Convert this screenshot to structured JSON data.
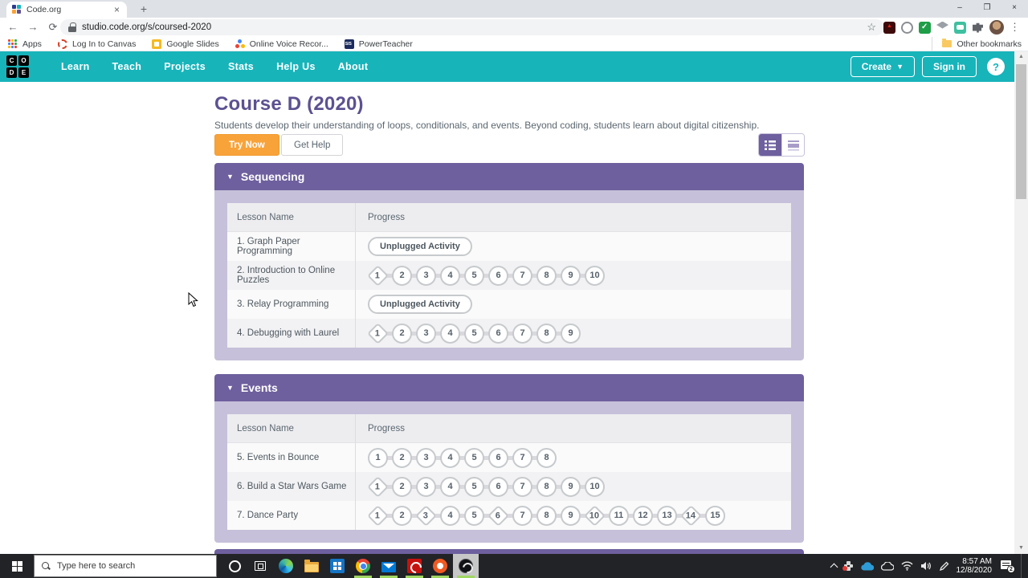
{
  "ui_glyphs": {
    "back": "←",
    "forward": "→",
    "reload": "⟳",
    "star": "☆",
    "menu_dots": "⋮",
    "tab_close": "×",
    "new_tab": "+",
    "win_min": "–",
    "win_max": "❐",
    "win_close": "×",
    "caret_down": "▼",
    "scroll_up": "▲",
    "scroll_down": "▼"
  },
  "browser": {
    "tab_title": "Code.org",
    "url": "studio.code.org/s/coursed-2020",
    "bookmarks": [
      {
        "label": "Apps",
        "icon": "apps-grid-icon",
        "cls": "bm-apps",
        "dots": 9
      },
      {
        "label": "Log In to Canvas",
        "icon": "canvas-icon",
        "cls": "bm-canvas",
        "dots": 0
      },
      {
        "label": "Google Slides",
        "icon": "google-slides-icon",
        "cls": "bm-slides",
        "dots": 0
      },
      {
        "label": "Online Voice Recor...",
        "icon": "voice-recorder-icon",
        "cls": "bm-voice",
        "dots": 3
      },
      {
        "label": "PowerTeacher",
        "icon": "sis-icon",
        "cls": "bm-sis",
        "dots": 0
      }
    ],
    "other_bookmarks_label": "Other bookmarks",
    "extensions": [
      {
        "icon": "acrobat-extension-icon",
        "cls": "ext-acrobat"
      },
      {
        "icon": "ring-extension-icon",
        "cls": "ext-ring"
      },
      {
        "icon": "check-extension-icon",
        "cls": "ext-check"
      },
      {
        "icon": "dropbox-extension-icon",
        "cls": "ext-dropbox"
      },
      {
        "icon": "screencast-extension-icon",
        "cls": "ext-screencast"
      },
      {
        "icon": "extensions-puzzle-icon",
        "cls": "ext-puzzle"
      }
    ]
  },
  "site_nav": {
    "logo_letters": [
      "C",
      "O",
      "D",
      "E"
    ],
    "items": [
      "Learn",
      "Teach",
      "Projects",
      "Stats",
      "Help Us",
      "About"
    ],
    "create_label": "Create",
    "sign_in_label": "Sign in",
    "help_label": "?"
  },
  "page": {
    "title": "Course D (2020)",
    "description": "Students develop their understanding of loops, conditionals, and events. Beyond coding, students learn about digital citizenship.",
    "try_now_label": "Try Now",
    "get_help_label": "Get Help"
  },
  "table": {
    "lesson_col": "Lesson Name",
    "progress_col": "Progress",
    "unplugged_label": "Unplugged Activity"
  },
  "sections": [
    {
      "title": "Sequencing",
      "lessons": [
        {
          "name": "1. Graph Paper Programming",
          "progress": "unplugged"
        },
        {
          "name": "2. Introduction to Online Puzzles",
          "progress": "bubbles",
          "count": 10,
          "diamonds": [
            1
          ]
        },
        {
          "name": "3. Relay Programming",
          "progress": "unplugged"
        },
        {
          "name": "4. Debugging with Laurel",
          "progress": "bubbles",
          "count": 9,
          "diamonds": [
            1
          ]
        }
      ]
    },
    {
      "title": "Events",
      "lessons": [
        {
          "name": "5. Events in Bounce",
          "progress": "bubbles",
          "count": 8,
          "diamonds": []
        },
        {
          "name": "6. Build a Star Wars Game",
          "progress": "bubbles",
          "count": 10,
          "diamonds": [
            1
          ]
        },
        {
          "name": "7. Dance Party",
          "progress": "bubbles",
          "count": 15,
          "diamonds": [
            1,
            3,
            6,
            10,
            14
          ]
        }
      ]
    }
  ],
  "taskbar": {
    "search_placeholder": "Type here to search",
    "apps": [
      {
        "icon": "cortana-icon",
        "cls": "ic-cortana",
        "running": false,
        "active": false
      },
      {
        "icon": "task-view-icon",
        "cls": "ic-taskview",
        "running": false,
        "active": false
      },
      {
        "icon": "edge-icon",
        "cls": "ic-edge",
        "running": false,
        "active": false
      },
      {
        "icon": "file-explorer-icon",
        "cls": "ic-folder",
        "running": false,
        "active": false
      },
      {
        "icon": "microsoft-store-icon",
        "cls": "ic-store",
        "running": false,
        "active": false
      },
      {
        "icon": "chrome-icon",
        "cls": "ic-chrome",
        "running": true,
        "active": false
      },
      {
        "icon": "mail-icon",
        "cls": "ic-mail",
        "running": true,
        "active": false
      },
      {
        "icon": "acrobat-icon",
        "cls": "ic-acrobat",
        "running": true,
        "active": false
      },
      {
        "icon": "origin-icon",
        "cls": "ic-origin",
        "running": true,
        "active": false
      },
      {
        "icon": "obs-icon",
        "cls": "ic-obs",
        "running": true,
        "active": true
      }
    ],
    "tray": {
      "time": "8:57 AM",
      "date": "12/8/2020",
      "notification_count": "2"
    }
  }
}
